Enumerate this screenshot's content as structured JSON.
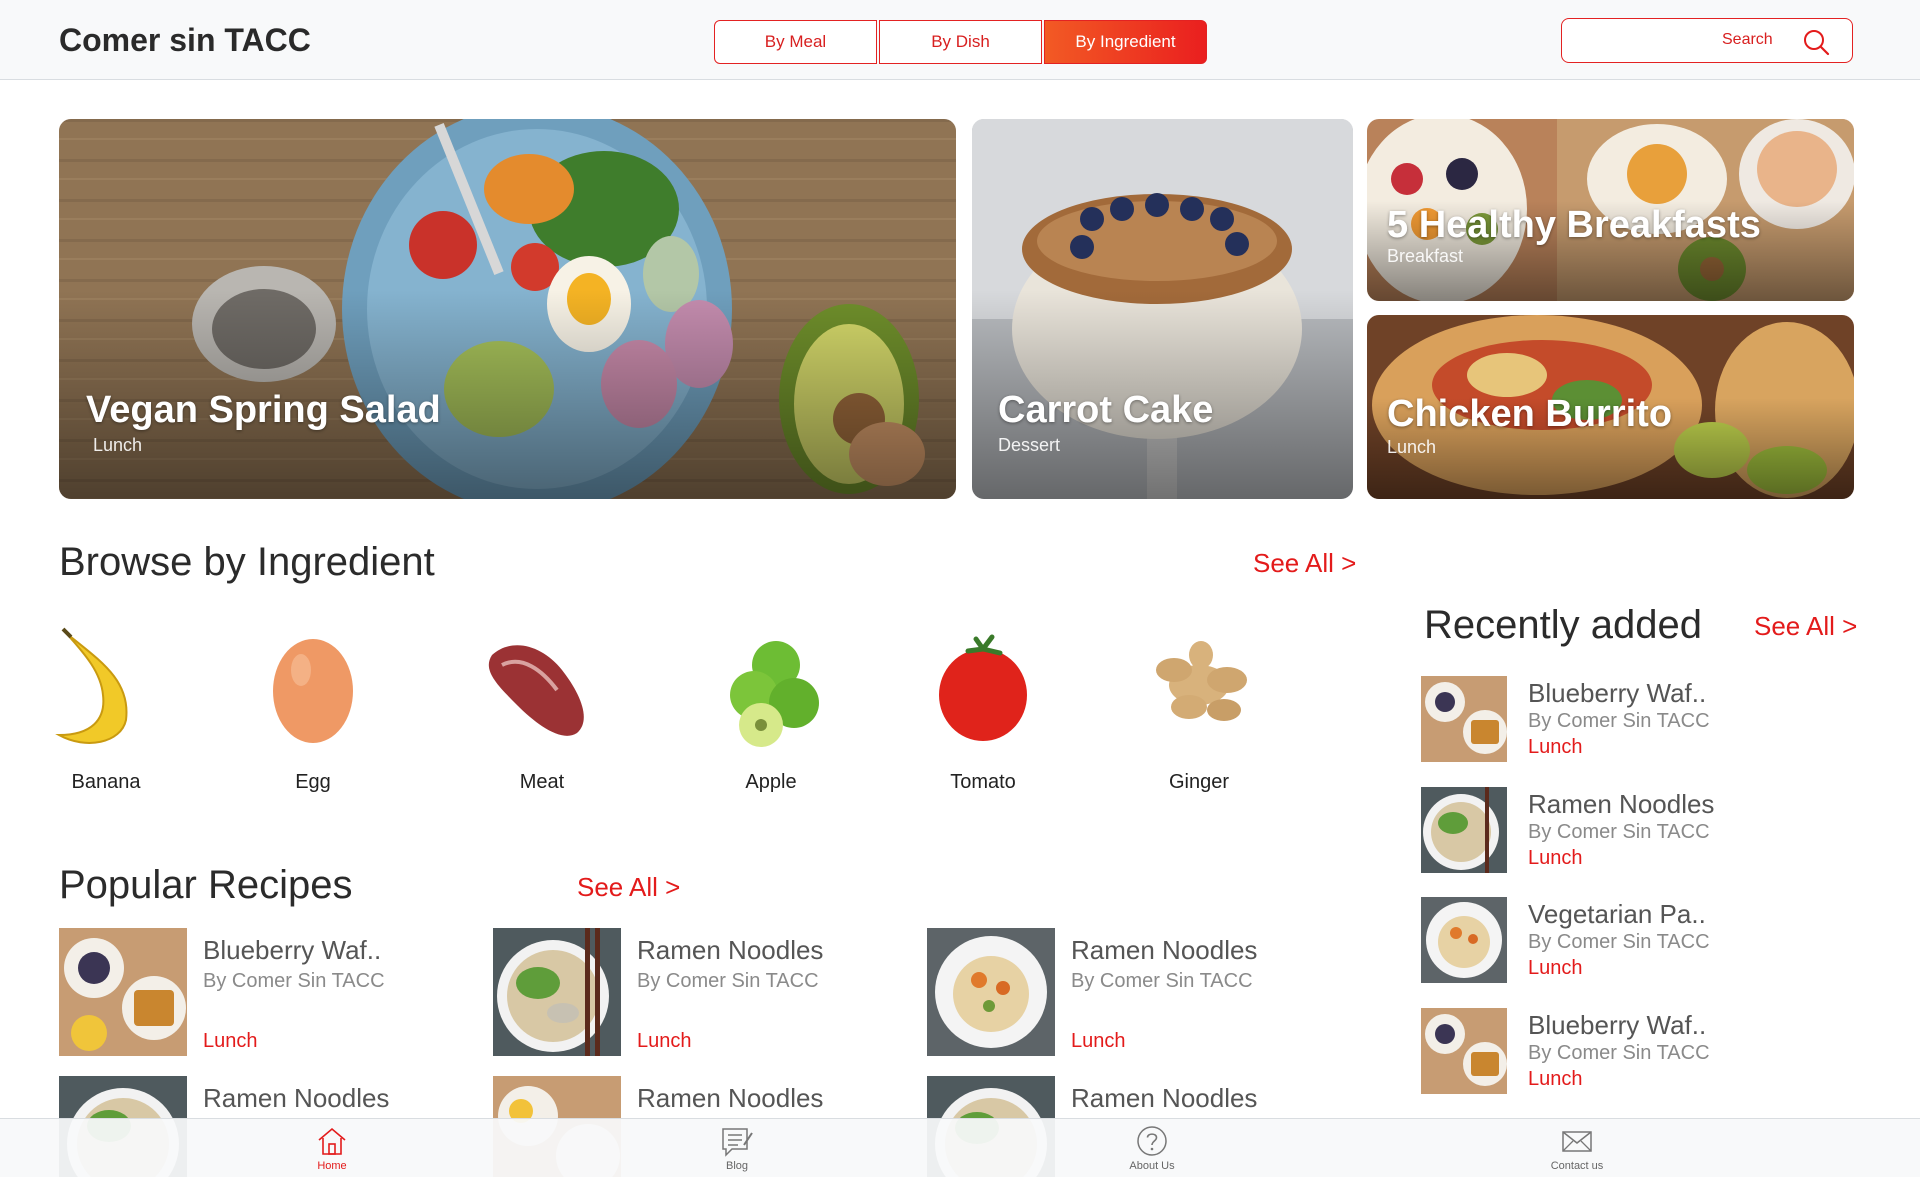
{
  "header": {
    "logo": "Comer sin TACC",
    "tabs": [
      "By Meal",
      "By Dish",
      "By Ingredient"
    ],
    "active_tab": "By Ingredient",
    "search": {
      "placeholder": "Search"
    }
  },
  "hero": [
    {
      "title": "Vegan Spring Salad",
      "category": "Lunch"
    },
    {
      "title": "Carrot Cake",
      "category": "Dessert"
    },
    {
      "title": "5 Healthy Breakfasts",
      "category": "Breakfast"
    },
    {
      "title": "Chicken Burrito",
      "category": "Lunch"
    }
  ],
  "ingredients": {
    "title": "Browse by Ingredient",
    "see_all": "See All >",
    "items": [
      "Banana",
      "Egg",
      "Meat",
      "Apple",
      "Tomato",
      "Ginger"
    ]
  },
  "popular": {
    "title": "Popular Recipes",
    "see_all": "See All >",
    "items": [
      {
        "title": "Blueberry Waf..",
        "author": "By Comer Sin TACC",
        "category": "Lunch"
      },
      {
        "title": "Ramen Noodles",
        "author": "By Comer Sin TACC",
        "category": "Lunch"
      },
      {
        "title": "Ramen Noodles",
        "author": "By Comer Sin TACC",
        "category": "Lunch"
      },
      {
        "title": "Ramen Noodles"
      },
      {
        "title": "Ramen Noodles"
      },
      {
        "title": "Ramen Noodles"
      }
    ]
  },
  "recent": {
    "title": "Recently added",
    "see_all": "See All >",
    "items": [
      {
        "title": "Blueberry Waf..",
        "author": "By Comer Sin TACC",
        "category": "Lunch"
      },
      {
        "title": "Ramen Noodles",
        "author": "By Comer Sin TACC",
        "category": "Lunch"
      },
      {
        "title": "Vegetarian Pa..",
        "author": "By Comer Sin TACC",
        "category": "Lunch"
      },
      {
        "title": "Blueberry Waf..",
        "author": "By Comer Sin TACC",
        "category": "Lunch"
      }
    ]
  },
  "bottom_nav": {
    "items": [
      {
        "label": "Home",
        "icon": "home-icon"
      },
      {
        "label": "Blog",
        "icon": "blog-icon"
      },
      {
        "label": "About Us",
        "icon": "question-icon"
      },
      {
        "label": "Contact us",
        "icon": "mail-icon"
      }
    ],
    "active": "Home"
  },
  "colors": {
    "accent": "#e31b1b",
    "accent_gradient_start": "#f25a24"
  }
}
